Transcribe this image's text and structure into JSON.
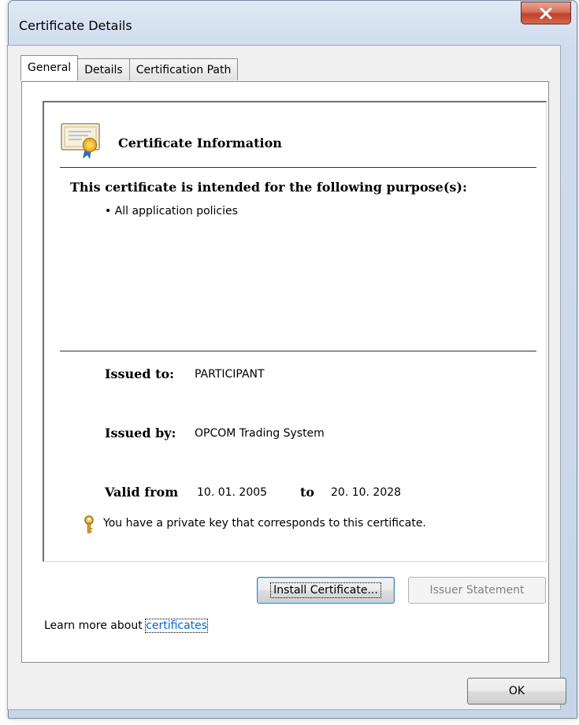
{
  "window": {
    "title": "Certificate Details"
  },
  "tabs": [
    {
      "label": "General",
      "active": true
    },
    {
      "label": "Details",
      "active": false
    },
    {
      "label": "Certification Path",
      "active": false
    }
  ],
  "info": {
    "title": "Certificate Information",
    "purpose_heading": "This certificate is intended for the following purpose(s):",
    "purposes": [
      "• All application policies"
    ]
  },
  "fields": {
    "issued_to_label": "Issued to:",
    "issued_to_value": "PARTICIPANT",
    "issued_by_label": "Issued by:",
    "issued_by_value": "OPCOM Trading System",
    "valid_from_label": "Valid from",
    "valid_from_value": "10. 01. 2005",
    "valid_to_label": "to",
    "valid_to_value": "20. 10. 2028"
  },
  "private_key_text": "You have a private key that corresponds to this certificate.",
  "buttons": {
    "install": "Install Certificate...",
    "issuer_statement": "Issuer Statement",
    "ok": "OK"
  },
  "learn_more": {
    "prefix": "Learn more about ",
    "link": "certificates"
  },
  "icons": {
    "close": "close-icon",
    "certificate": "certificate-icon",
    "key": "key-icon"
  },
  "colors": {
    "link": "#0066cc",
    "close_button": "#c7432c",
    "title_bar": "#cfdced"
  }
}
